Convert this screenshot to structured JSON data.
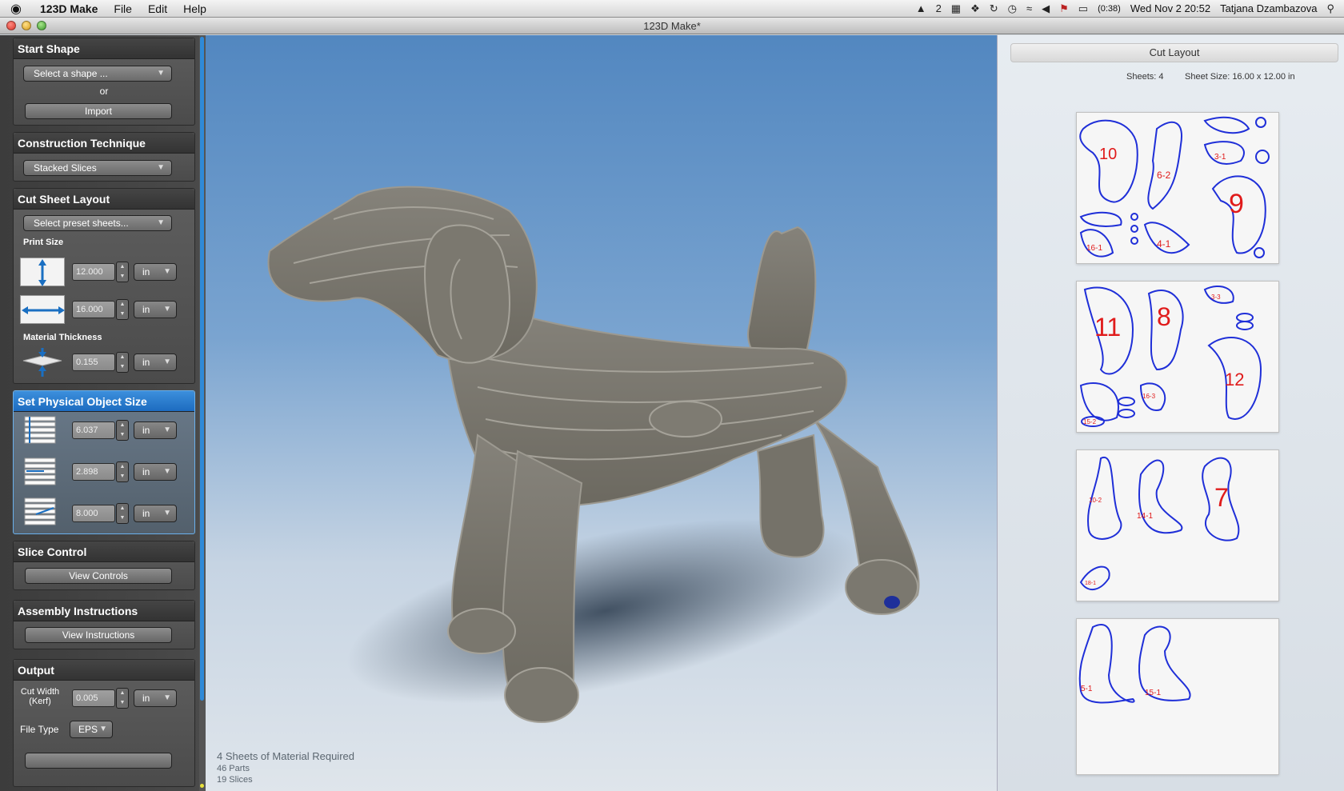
{
  "menubar": {
    "apple": "",
    "app": "123D Make",
    "items": [
      "File",
      "Edit",
      "Help"
    ],
    "status_2": "2",
    "battery": "(0:38)",
    "datetime": "Wed Nov 2  20:52",
    "user": "Tatjana Dzambazova"
  },
  "window": {
    "title": "123D Make*"
  },
  "left": {
    "start_shape": {
      "title": "Start Shape",
      "select": "Select a shape ...",
      "or": "or",
      "import": "Import"
    },
    "construction": {
      "title": "Construction Technique",
      "select": "Stacked Slices"
    },
    "cut_sheet": {
      "title": "Cut Sheet Layout",
      "preset": "Select preset sheets...",
      "print_size": "Print Size",
      "height": "12.000",
      "height_unit": "in",
      "width": "16.000",
      "width_unit": "in",
      "material_thickness": "Material Thickness",
      "thickness": "0.155",
      "thickness_unit": "in"
    },
    "object_size": {
      "title": "Set Physical Object Size",
      "h": "6.037",
      "h_unit": "in",
      "w": "2.898",
      "w_unit": "in",
      "d": "8.000",
      "d_unit": "in"
    },
    "slice_control": {
      "title": "Slice Control",
      "button": "View Controls"
    },
    "assembly": {
      "title": "Assembly Instructions",
      "button": "View Instructions"
    },
    "output": {
      "title": "Output",
      "cut_width_1": "Cut Width",
      "cut_width_2": "(Kerf)",
      "kerf": "0.005",
      "kerf_unit": "in",
      "file_type_label": "File Type",
      "file_type": "EPS"
    }
  },
  "viewport": {
    "sheets_required": "4 Sheets of Material Required",
    "parts": "46 Parts",
    "slices": "19 Slices"
  },
  "right": {
    "title": "Cut Layout",
    "sheets": "Sheets: 4",
    "sheet_size": "Sheet Size: 16.00 x 12.00 in",
    "sheet1": {
      "labels": [
        "10",
        "6-2",
        "3-1",
        "9",
        "16-1",
        "4-1"
      ]
    },
    "sheet2": {
      "labels": [
        "11",
        "8",
        "12",
        "3-3",
        "16-3",
        "15-2"
      ]
    },
    "sheet3": {
      "labels": [
        "10-2",
        "14-1",
        "7",
        "18-1"
      ]
    },
    "sheet4": {
      "labels": [
        "5-1",
        "15-1"
      ]
    }
  },
  "colors": {
    "accent": "#1d6cc0",
    "part_outline": "#1f2fd8",
    "part_label": "#e01b1b",
    "part_fill_hint": "#e6e23a"
  }
}
